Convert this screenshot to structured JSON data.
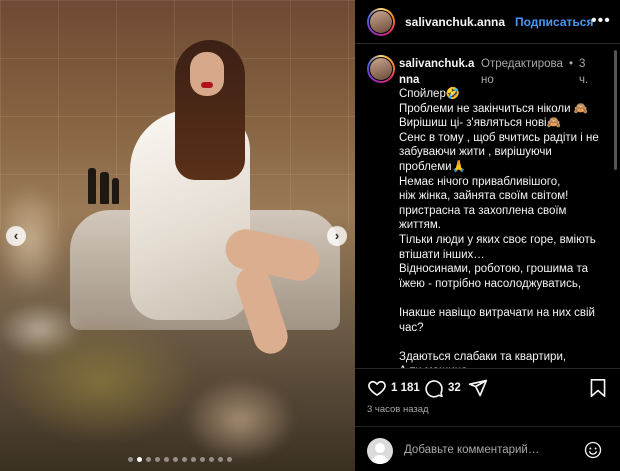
{
  "header": {
    "username": "salivanchuk.anna",
    "follow_label": "Подписаться",
    "more_label": "•••"
  },
  "caption": {
    "username": "salivanchuk.anna",
    "edited": "Отредактировано",
    "separator": "•",
    "time": "3 ч.",
    "lines": [
      "Спойлер🤣",
      "Проблеми не закінчиться ніколи 🙈",
      "Вирішиш ці- з'являться нові🙈",
      "Сенс в тому , щоб вчитись радіти і не",
      "забуваючи жити , вирішуючи",
      "проблеми🙏",
      "Немає нічого привабливішого,",
      "ніж жінка, зайнята своїм світом!",
      "пристрасна та захоплена своїм",
      "життям.",
      "Тільки люди у яких своє горе, вміють",
      "втішати інших…",
      "Відносинами, роботою, грошима та",
      "їжею - потрібно насолоджуватись,",
      "",
      "Інакше навіщо витрачати на них свій",
      "час?",
      "",
      "Здаються слабаки та квартири,",
      "А ти машина"
    ]
  },
  "media": {
    "prev_label": "‹",
    "next_label": "›",
    "slide_count": 12,
    "active_slide": 1
  },
  "actions": {
    "likes": "1 181",
    "comments": "32",
    "time_ago": "3 часов назад"
  },
  "comment_box": {
    "placeholder": "Добавьте комментарий…"
  },
  "icons": {
    "like": "heart-icon",
    "comment": "comment-bubble-icon",
    "share": "paper-plane-icon",
    "save": "bookmark-icon",
    "emoji": "smiley-icon",
    "prev": "chevron-left-icon",
    "next": "chevron-right-icon"
  },
  "colors": {
    "follow": "#4a99f5",
    "background": "#000000",
    "muted_text": "#a8a8a8"
  }
}
